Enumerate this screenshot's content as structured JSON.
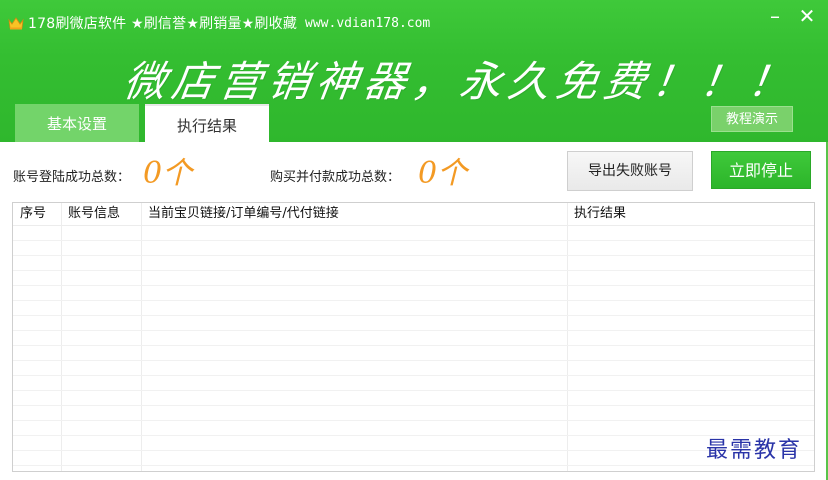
{
  "window": {
    "title": "178刷微店软件 ★刷信誉★刷销量★刷收藏",
    "url": "www.vdian178.com",
    "minimize_glyph": "–",
    "close_glyph": "✕"
  },
  "header": {
    "slogan": "微店营销神器，永久免费！！！"
  },
  "tabs": [
    {
      "label": "基本设置"
    },
    {
      "label": "执行结果"
    }
  ],
  "buttons": {
    "tutorial": "教程演示",
    "export_failed": "导出失败账号",
    "stop_now": "立即停止"
  },
  "stats": {
    "login_label": "账号登陆成功总数：",
    "login_value": "0个",
    "pay_label": "购买并付款成功总数：",
    "pay_value": "0个"
  },
  "table": {
    "columns": [
      "序号",
      "账号信息",
      "当前宝贝链接/订单编号/代付链接",
      "执行结果"
    ],
    "rows": []
  },
  "watermark": "最需教育",
  "colors": {
    "header_green": "#34be31",
    "accent_orange": "#f39a24",
    "stop_green": "#2cb52a"
  },
  "icons": {
    "title": "crown-icon"
  }
}
